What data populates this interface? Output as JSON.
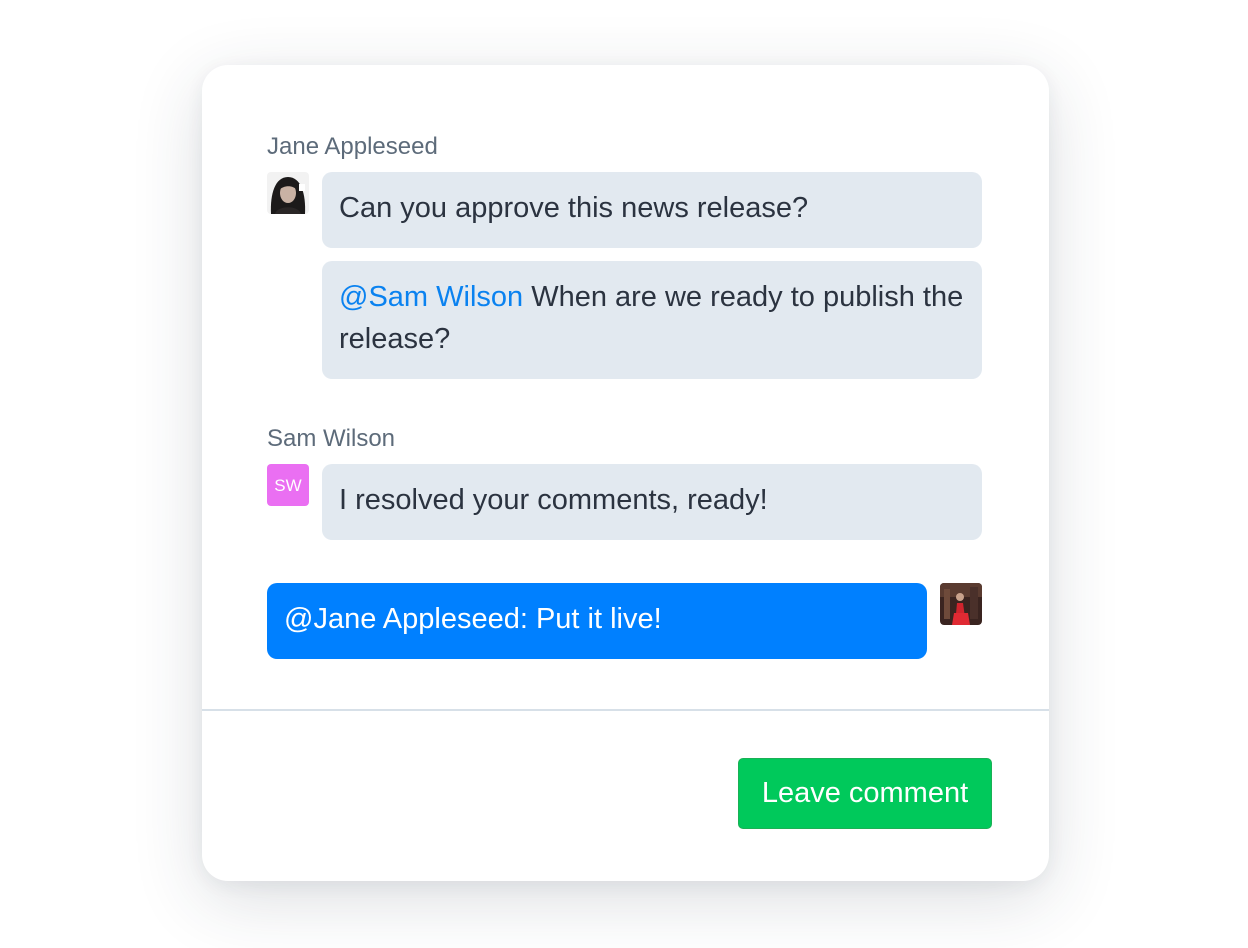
{
  "thread": [
    {
      "author": "Jane Appleseed",
      "avatar": "jane-photo",
      "messages": [
        {
          "text": "Can you approve this news release?"
        },
        {
          "mention": "@Sam Wilson",
          "text": " When are we ready to publish the release?"
        }
      ]
    },
    {
      "author": "Sam Wilson",
      "avatar_initials": "SW",
      "messages": [
        {
          "text": "I resolved your comments, ready!"
        }
      ]
    },
    {
      "own": true,
      "avatar": "current-user-photo",
      "messages": [
        {
          "text": "@Jane Appleseed: Put it live!"
        }
      ]
    }
  ],
  "actions": {
    "leave_comment_label": "Leave comment"
  },
  "colors": {
    "bubble_bg": "#e2e9f0",
    "own_bubble_bg": "#0080ff",
    "mention": "#0a82f0",
    "button_bg": "#00c95b",
    "initials_avatar_bg": "#ea6ff2"
  }
}
